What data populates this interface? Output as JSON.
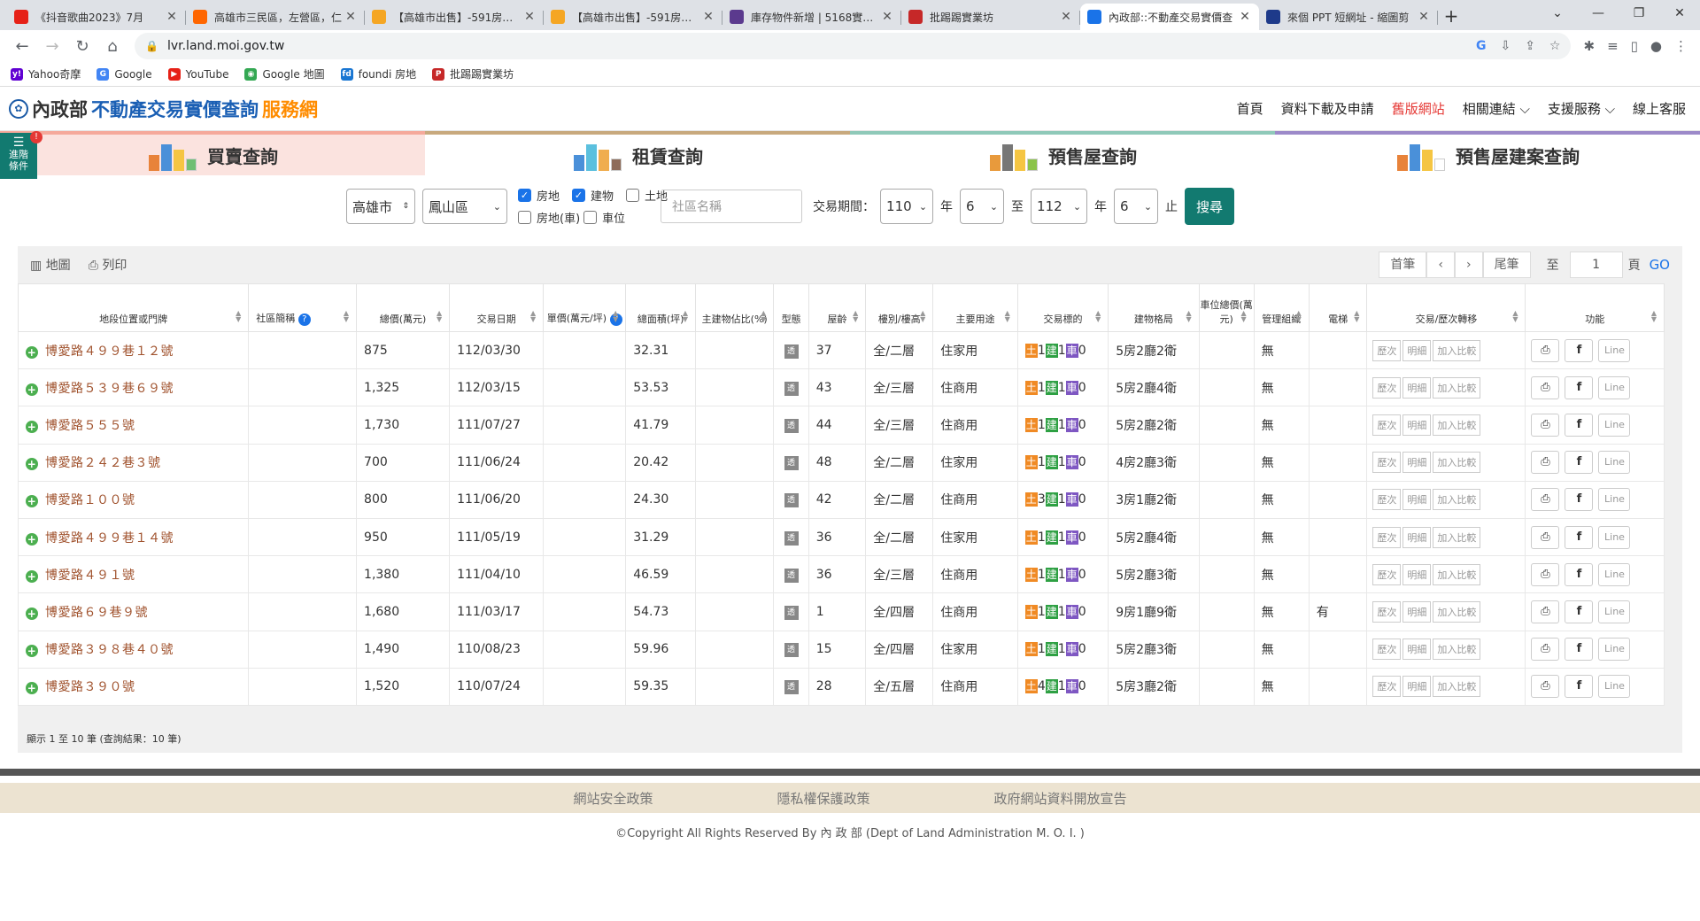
{
  "browser": {
    "tabs": [
      {
        "title": "《抖音歌曲2023》7月",
        "color": "#e62117",
        "active": false
      },
      {
        "title": "高雄市三民區，左營區，仁",
        "color": "#ff6600",
        "active": false
      },
      {
        "title": "【高雄市出售】-591房屋交",
        "color": "#f5a623",
        "active": false
      },
      {
        "title": "【高雄市出售】-591房屋交",
        "color": "#f5a623",
        "active": false
      },
      {
        "title": "庫存物件新增 | 5168實價登",
        "color": "#5b3a8e",
        "active": false
      },
      {
        "title": "批踢踢實業坊",
        "color": "#c62828",
        "active": false
      },
      {
        "title": "內政部::不動產交易實價查",
        "color": "#1a73e8",
        "active": true
      },
      {
        "title": "來個 PPT 短網址 - 縮圖剪",
        "color": "#1e3a8a",
        "active": false
      }
    ],
    "url": "lvr.land.moi.gov.tw",
    "bookmarks": [
      {
        "label": "Yahoo奇摩",
        "color": "#6001d2",
        "glyph": "y!"
      },
      {
        "label": "Google",
        "color": "#4285f4",
        "glyph": "G"
      },
      {
        "label": "YouTube",
        "color": "#e62117",
        "glyph": "▶"
      },
      {
        "label": "Google 地圖",
        "color": "#34a853",
        "glyph": "◉"
      },
      {
        "label": "foundi 房地",
        "color": "#1976d2",
        "glyph": "fd"
      },
      {
        "label": "批踢踢實業坊",
        "color": "#c62828",
        "glyph": "P"
      }
    ]
  },
  "site": {
    "logo_moi": "內政部",
    "logo_main": "不動產交易實價查詢",
    "logo_suffix": "服務網",
    "nav": [
      "首頁",
      "資料下載及申請",
      "舊版網站",
      "相關連結 ⌵",
      "支援服務 ⌵",
      "線上客服"
    ],
    "advanced": "進階條件",
    "categories": [
      {
        "label": "買賣查詢",
        "bg": "#fbe3df",
        "border": "#f5a99b"
      },
      {
        "label": "租賃查詢",
        "bg": "#ffffff",
        "border": "#c8a97e"
      },
      {
        "label": "預售屋查詢",
        "bg": "#ffffff",
        "border": "#8fc9b9"
      },
      {
        "label": "預售屋建案查詢",
        "bg": "#ffffff",
        "border": "#9c8ac9"
      }
    ]
  },
  "search": {
    "city": "高雄市",
    "district": "鳳山區",
    "opt_land": "房地",
    "opt_building": "建物",
    "opt_soil": "土地",
    "opt_land_car": "房地(車)",
    "opt_car": "車位",
    "community_placeholder": "社區名稱",
    "period_label": "交易期間：",
    "from_year": "110",
    "from_month": "6",
    "to_year": "112",
    "to_month": "6",
    "year_unit": "年",
    "to_word": "至",
    "end_word": "止",
    "button": "搜尋"
  },
  "results": {
    "map_label": "地圖",
    "print_label": "列印",
    "pager": {
      "first": "首筆",
      "prev": "‹",
      "next": "›",
      "last": "尾筆",
      "to": "至",
      "page": "1",
      "page_unit": "頁",
      "go": "GO"
    },
    "headers": [
      "地段位置或門牌",
      "社區簡稱",
      "總價(萬元)",
      "交易日期",
      "單價(萬元/坪)",
      "總面積(坪)",
      "主建物佔比(%)",
      "型態",
      "屋齡",
      "樓別/樓高",
      "主要用途",
      "交易標的",
      "建物格局",
      "車位總價(萬元)",
      "管理組織",
      "電梯",
      "交易/歷次轉移",
      "功能"
    ],
    "rows": [
      {
        "addr": "博愛路４９９巷１２號",
        "price": "875",
        "date": "112/03/30",
        "area": "32.31",
        "age": "37",
        "floor": "全/二層",
        "use": "住家用",
        "land": "1",
        "bld": "1",
        "car": "0",
        "layout": "5房2廳2衛",
        "mgmt": "無",
        "elev": ""
      },
      {
        "addr": "博愛路５３９巷６９號",
        "price": "1,325",
        "date": "112/03/15",
        "area": "53.53",
        "age": "43",
        "floor": "全/三層",
        "use": "住商用",
        "land": "1",
        "bld": "1",
        "car": "0",
        "layout": "5房2廳4衛",
        "mgmt": "無",
        "elev": ""
      },
      {
        "addr": "博愛路５５５號",
        "price": "1,730",
        "date": "111/07/27",
        "area": "41.79",
        "age": "44",
        "floor": "全/三層",
        "use": "住商用",
        "land": "1",
        "bld": "1",
        "car": "0",
        "layout": "5房2廳2衛",
        "mgmt": "無",
        "elev": ""
      },
      {
        "addr": "博愛路２４２巷３號",
        "price": "700",
        "date": "111/06/24",
        "area": "20.42",
        "age": "48",
        "floor": "全/二層",
        "use": "住家用",
        "land": "1",
        "bld": "1",
        "car": "0",
        "layout": "4房2廳3衛",
        "mgmt": "無",
        "elev": ""
      },
      {
        "addr": "博愛路１００號",
        "price": "800",
        "date": "111/06/20",
        "area": "24.30",
        "age": "42",
        "floor": "全/二層",
        "use": "住商用",
        "land": "3",
        "bld": "1",
        "car": "0",
        "layout": "3房1廳2衛",
        "mgmt": "無",
        "elev": ""
      },
      {
        "addr": "博愛路４９９巷１４號",
        "price": "950",
        "date": "111/05/19",
        "area": "31.29",
        "age": "36",
        "floor": "全/二層",
        "use": "住家用",
        "land": "1",
        "bld": "1",
        "car": "0",
        "layout": "5房2廳4衛",
        "mgmt": "無",
        "elev": ""
      },
      {
        "addr": "博愛路４９１號",
        "price": "1,380",
        "date": "111/04/10",
        "area": "46.59",
        "age": "36",
        "floor": "全/三層",
        "use": "住商用",
        "land": "1",
        "bld": "1",
        "car": "0",
        "layout": "5房2廳3衛",
        "mgmt": "無",
        "elev": ""
      },
      {
        "addr": "博愛路６９巷９號",
        "price": "1,680",
        "date": "111/03/17",
        "area": "54.73",
        "age": "1",
        "floor": "全/四層",
        "use": "住商用",
        "land": "1",
        "bld": "1",
        "car": "0",
        "layout": "9房1廳9衛",
        "mgmt": "無",
        "elev": "有"
      },
      {
        "addr": "博愛路３９８巷４０號",
        "price": "1,490",
        "date": "110/08/23",
        "area": "59.96",
        "age": "15",
        "floor": "全/四層",
        "use": "住家用",
        "land": "1",
        "bld": "1",
        "car": "0",
        "layout": "5房2廳3衛",
        "mgmt": "無",
        "elev": ""
      },
      {
        "addr": "博愛路３９０號",
        "price": "1,520",
        "date": "110/07/24",
        "area": "59.35",
        "age": "28",
        "floor": "全/五層",
        "use": "住商用",
        "land": "4",
        "bld": "1",
        "car": "0",
        "layout": "5房3廳2衛",
        "mgmt": "無",
        "elev": ""
      }
    ],
    "type_glyph": "透",
    "tag_land": "土",
    "tag_bld": "建",
    "tag_car": "車",
    "btn_history": "歷次",
    "btn_detail": "明細",
    "btn_compare": "加入比較",
    "btn_line": "Line",
    "summary": "顯示 1 至 10 筆 (查詢結果：10 筆)"
  },
  "footer": {
    "links": [
      "網站安全政策",
      "隱私權保護政策",
      "政府網站資料開放宣告"
    ],
    "copyright": "©Copyright All Rights Reserved By 內 政 部 (Dept of Land Administration M. O. I. )"
  }
}
